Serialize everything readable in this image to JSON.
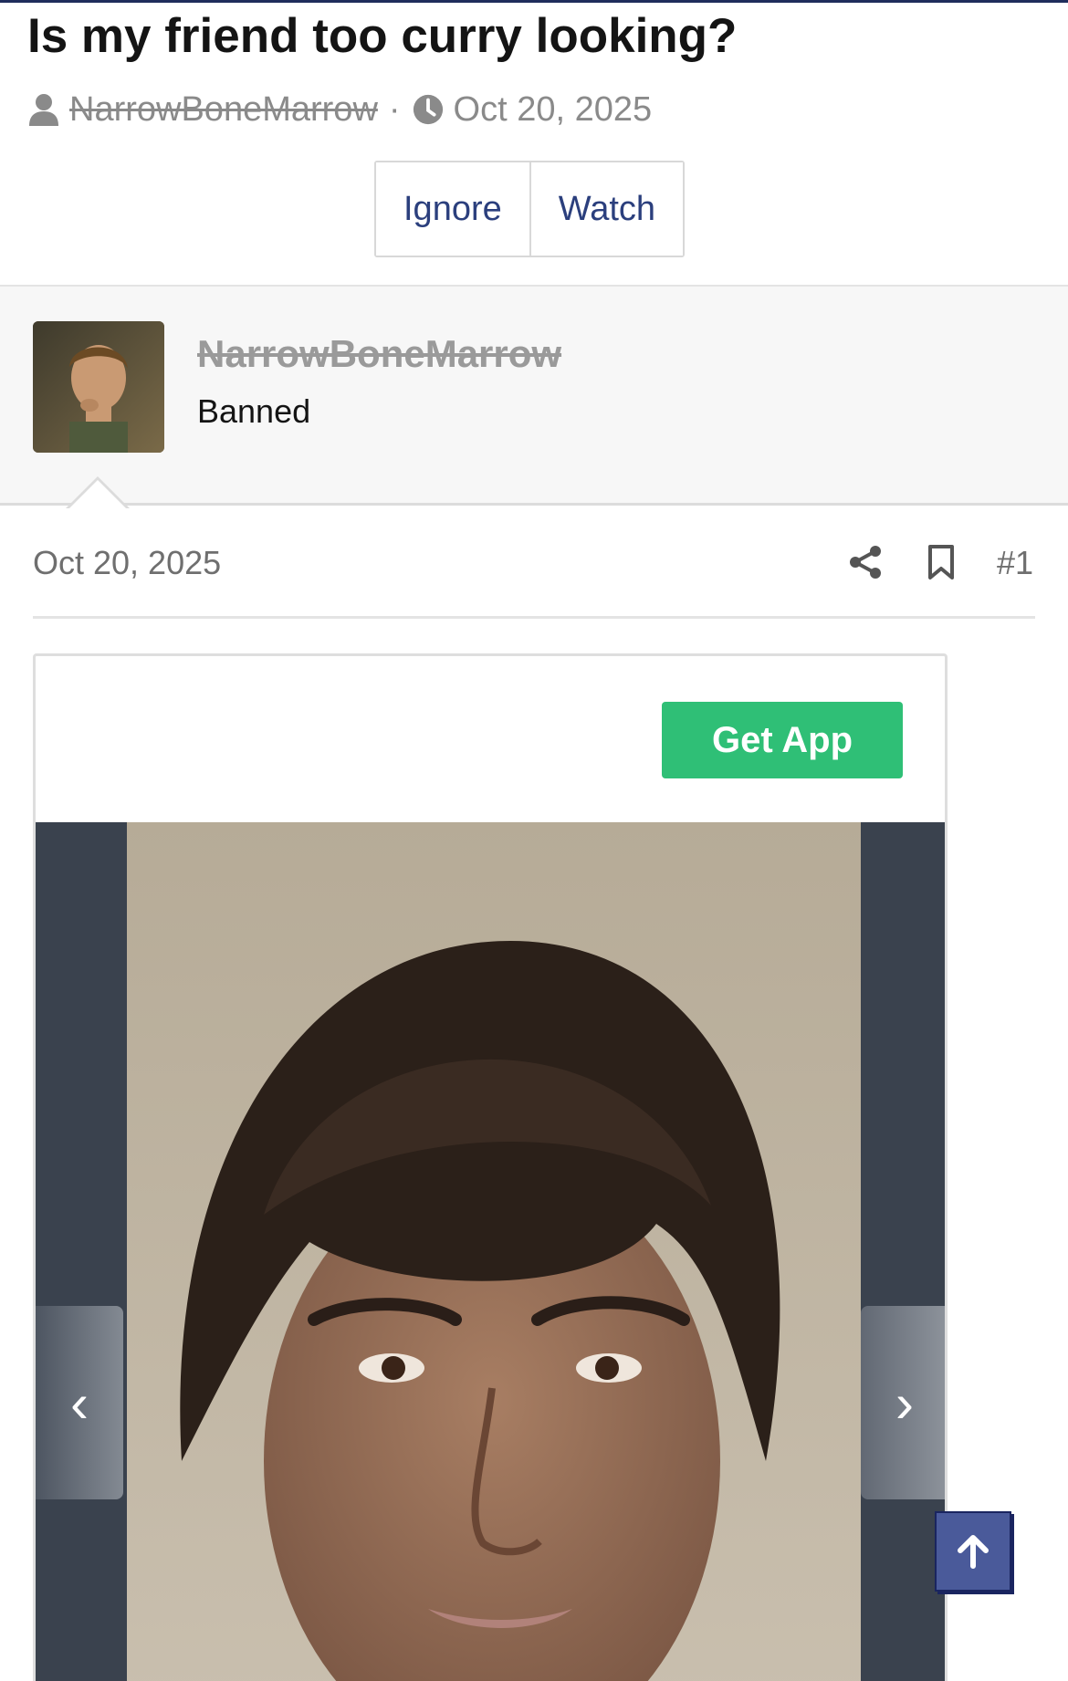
{
  "thread": {
    "title": "Is my friend too curry looking?",
    "author": "NarrowBoneMarrow",
    "separator": "·",
    "date": "Oct 20, 2025"
  },
  "actions": {
    "ignore_label": "Ignore",
    "watch_label": "Watch"
  },
  "user": {
    "name": "NarrowBoneMarrow",
    "title": "Banned"
  },
  "post": {
    "date": "Oct 20, 2025",
    "number": "#1"
  },
  "embed": {
    "get_app_label": "Get App",
    "prev_glyph": "‹",
    "next_glyph": "›"
  },
  "colors": {
    "accent": "#2b3f7d",
    "get_app": "#2fbf76",
    "scroll_top": "#4a5a9a",
    "gallery_bg": "#3a424e"
  },
  "icons": [
    "user-icon",
    "clock-icon",
    "share-icon",
    "bookmark-icon",
    "arrow-up-icon",
    "chevron-left-icon",
    "chevron-right-icon"
  ]
}
